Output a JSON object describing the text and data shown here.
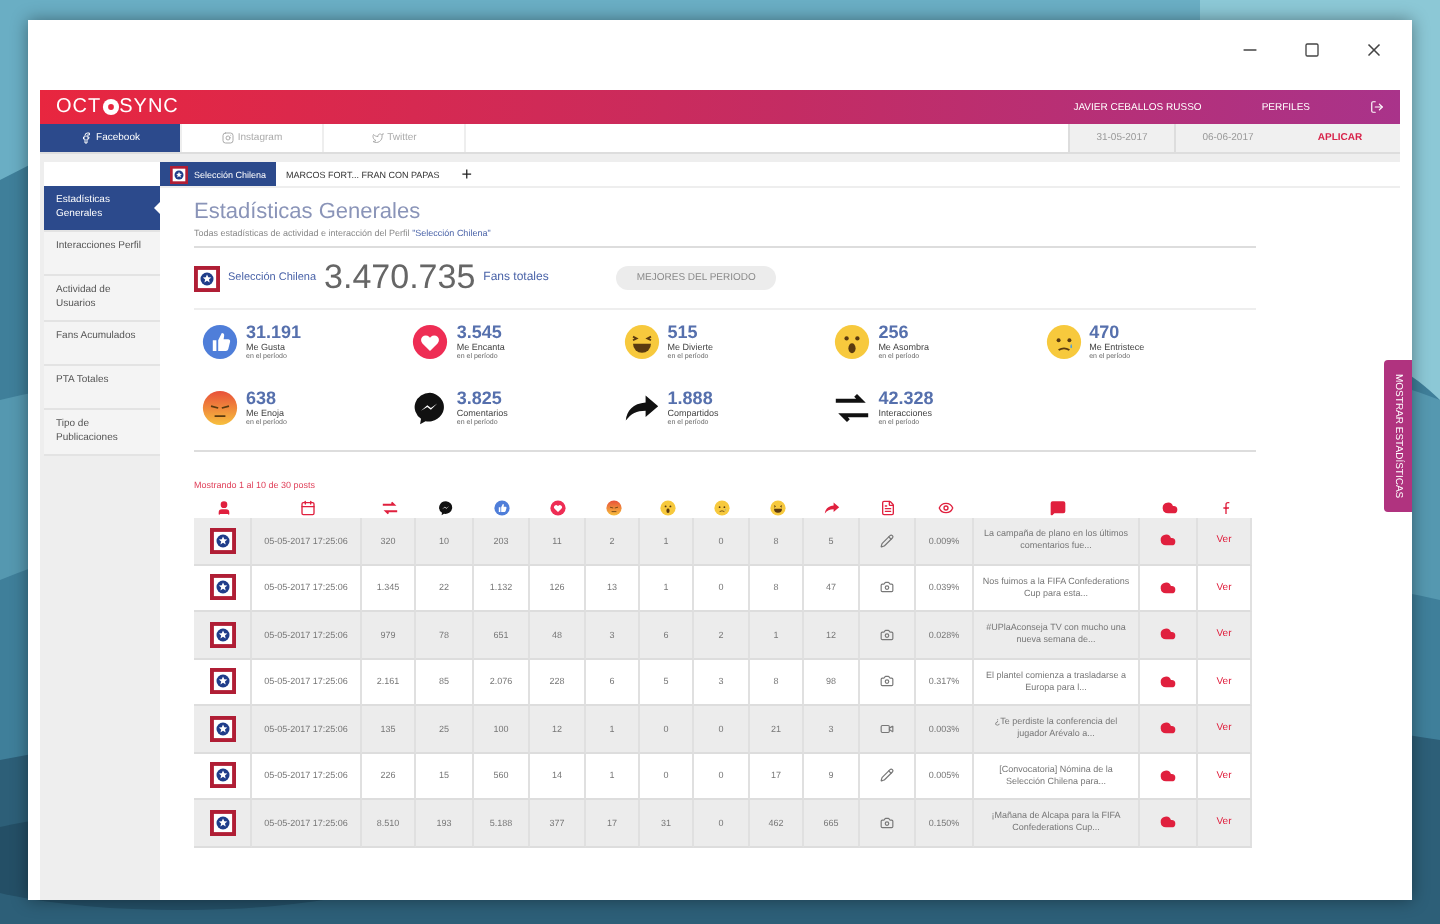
{
  "header": {
    "logo_left": "OCT",
    "logo_right": "SYNC",
    "user": "JAVIER CEBALLOS RUSSO",
    "profiles": "PERFILES"
  },
  "network_tabs": [
    {
      "label": "Facebook",
      "kind": "facebook",
      "selected": true
    },
    {
      "label": "Instagram",
      "kind": "instagram",
      "selected": false
    },
    {
      "label": "Twitter",
      "kind": "twitter",
      "selected": false
    }
  ],
  "date_range": {
    "start": "31-05-2017",
    "end": "06-06-2017",
    "apply": "APLICAR"
  },
  "profile_tabs": [
    {
      "label": "Selección Chilena",
      "selected": true
    },
    {
      "label": "MARCOS FORT... FRAN CON PAPAS",
      "selected": false
    }
  ],
  "add_tab": "+",
  "sidebar": {
    "items": [
      {
        "label": "Estadísticas Generales",
        "selected": true
      },
      {
        "label": "Interacciones Perfil",
        "selected": false
      },
      {
        "label": "Actividad de Usuarios",
        "selected": false
      },
      {
        "label": "Fans Acumulados",
        "selected": false
      },
      {
        "label": "PTA Totales",
        "selected": false
      },
      {
        "label": "Tipo de Publicaciones",
        "selected": false
      }
    ]
  },
  "page": {
    "title": "Estadísticas Generales",
    "subtitle": "Todas estadísticas de actividad e interacción del Perfil",
    "subtitle_profile": "\"Selección Chilena\""
  },
  "profile": {
    "name": "Selección Chilena",
    "fans": "3.470.735",
    "fans_label": "Fans totales",
    "best_button": {
      "label": "MEJORES DEL PERIODO",
      "disabled": true
    }
  },
  "stats": [
    {
      "kind": "like",
      "value": "31.191",
      "label": "Me Gusta",
      "note": "en el período"
    },
    {
      "kind": "love",
      "value": "3.545",
      "label": "Me Encanta",
      "note": "en el período"
    },
    {
      "kind": "haha",
      "value": "515",
      "label": "Me Divierte",
      "note": "en el período"
    },
    {
      "kind": "wow",
      "value": "256",
      "label": "Me Asombra",
      "note": "en el período"
    },
    {
      "kind": "sad",
      "value": "470",
      "label": "Me Entristece",
      "note": "en el período"
    },
    {
      "kind": "angry",
      "value": "638",
      "label": "Me Enoja",
      "note": "en el período"
    },
    {
      "kind": "comment",
      "value": "3.825",
      "label": "Comentarios",
      "note": "en el período"
    },
    {
      "kind": "share",
      "value": "1.888",
      "label": "Compartidos",
      "note": "en el período"
    },
    {
      "kind": "interactions",
      "value": "42.328",
      "label": "Interacciones",
      "note": "en el período"
    }
  ],
  "posts_count": "Mostrando 1 al 10 de 30 posts",
  "rows": [
    {
      "date": "05-05-2017 17:25:06",
      "values": [
        "320",
        "10",
        "203",
        "11",
        "2",
        "1",
        "0",
        "8",
        "5"
      ],
      "kind": "edit",
      "rate": "0.009%",
      "message": "La campaña de plano en los últimos comentarios fue...",
      "link": "Ver"
    },
    {
      "date": "05-05-2017 17:25:06",
      "values": [
        "1.345",
        "22",
        "1.132",
        "126",
        "13",
        "1",
        "0",
        "8",
        "47"
      ],
      "rate": "0.039%",
      "message": "Nos fuimos a la FIFA Confederations Cup para esta...",
      "link": "Ver"
    },
    {
      "date": "05-05-2017 17:25:06",
      "values": [
        "979",
        "78",
        "651",
        "48",
        "3",
        "6",
        "2",
        "1",
        "12"
      ],
      "rate": "0.028%",
      "message": "#UPlaAconseja TV con mucho una nueva semana de...",
      "link": "Ver"
    },
    {
      "date": "05-05-2017 17:25:06",
      "values": [
        "2.161",
        "85",
        "2.076",
        "228",
        "6",
        "5",
        "3",
        "8",
        "98"
      ],
      "rate": "0.317%",
      "message": "El plantel comienza a trasladarse a Europa para l...",
      "link": "Ver"
    },
    {
      "date": "05-05-2017 17:25:06",
      "values": [
        "135",
        "25",
        "100",
        "12",
        "1",
        "0",
        "0",
        "21",
        "3"
      ],
      "kind": "video",
      "rate": "0.003%",
      "message": "¿Te perdiste la conferencia del jugador Arévalo a...",
      "link": "Ver"
    },
    {
      "date": "05-05-2017 17:25:06",
      "values": [
        "226",
        "15",
        "560",
        "14",
        "1",
        "0",
        "0",
        "17",
        "9"
      ],
      "kind": "edit",
      "rate": "0.005%",
      "message": "[Convocatoria] Nómina de la Selección Chilena para...",
      "link": "Ver"
    },
    {
      "date": "05-05-2017 17:25:06",
      "values": [
        "8.510",
        "193",
        "5.188",
        "377",
        "17",
        "31",
        "0",
        "462",
        "665"
      ],
      "rate": "0.150%",
      "message": "¡Mañana de Alcapa para la FIFA Confederations Cup...",
      "link": "Ver"
    }
  ],
  "side_tab": "MOSTRAR ESTADÍSTICAS"
}
